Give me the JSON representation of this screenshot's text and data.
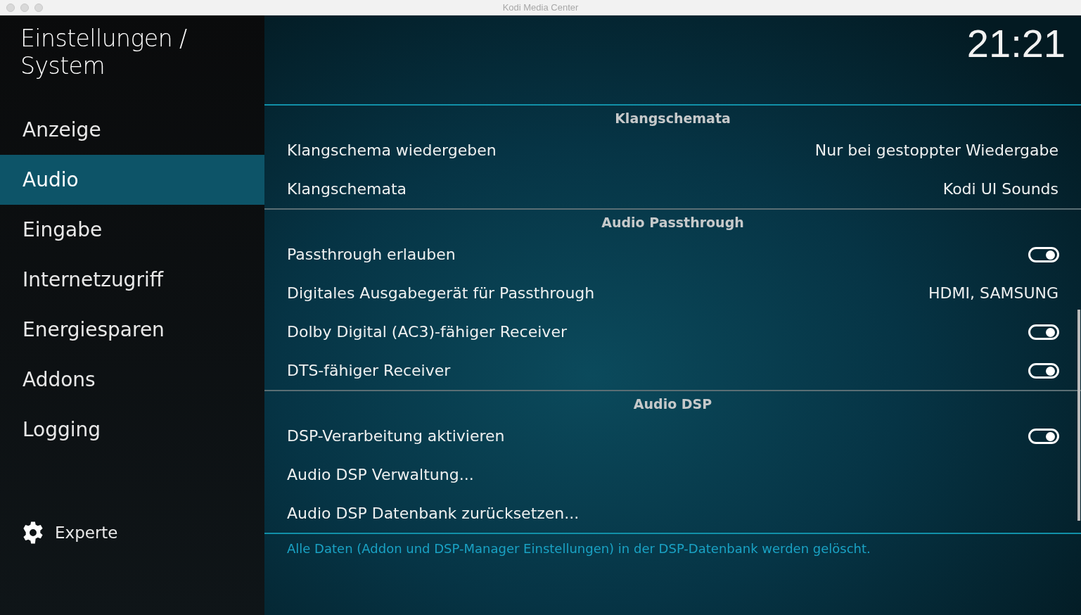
{
  "window": {
    "title": "Kodi Media Center"
  },
  "header": {
    "title": "Einstellungen / System",
    "clock": "21:21"
  },
  "sidebar": {
    "items": [
      {
        "label": "Anzeige",
        "selected": false
      },
      {
        "label": "Audio",
        "selected": true
      },
      {
        "label": "Eingabe",
        "selected": false
      },
      {
        "label": "Internetzugriff",
        "selected": false
      },
      {
        "label": "Energiesparen",
        "selected": false
      },
      {
        "label": "Addons",
        "selected": false
      },
      {
        "label": "Logging",
        "selected": false
      }
    ],
    "level_button": {
      "label": "Experte"
    }
  },
  "sections": [
    {
      "title": "Klangschemata",
      "rows": [
        {
          "kind": "value",
          "label": "Klangschema wiedergeben",
          "value": "Nur bei gestoppter Wiedergabe"
        },
        {
          "kind": "value",
          "label": "Klangschemata",
          "value": "Kodi UI Sounds"
        }
      ]
    },
    {
      "title": "Audio Passthrough",
      "rows": [
        {
          "kind": "toggle",
          "label": "Passthrough erlauben",
          "on": true
        },
        {
          "kind": "value",
          "label": "Digitales Ausgabegerät für Passthrough",
          "value": "HDMI, SAMSUNG"
        },
        {
          "kind": "toggle",
          "label": "Dolby Digital (AC3)-fähiger Receiver",
          "on": true
        },
        {
          "kind": "toggle",
          "label": "DTS-fähiger Receiver",
          "on": true
        }
      ]
    },
    {
      "title": "Audio DSP",
      "rows": [
        {
          "kind": "toggle",
          "label": "DSP-Verarbeitung aktivieren",
          "on": true
        },
        {
          "kind": "action",
          "label": "Audio DSP Verwaltung..."
        },
        {
          "kind": "action",
          "label": "Audio DSP Datenbank zurücksetzen..."
        }
      ]
    }
  ],
  "description": "Alle Daten (Addon und DSP-Manager Einstellungen) in der DSP-Datenbank werden gelöscht."
}
